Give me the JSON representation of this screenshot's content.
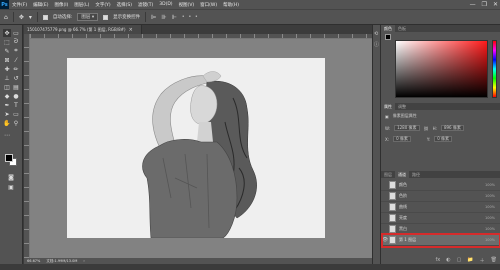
{
  "menubar": {
    "logo": "Ps",
    "items": [
      "文件(F)",
      "编辑(E)",
      "图像(I)",
      "图层(L)",
      "文字(Y)",
      "选择(S)",
      "滤镜(T)",
      "3D(D)",
      "视图(V)",
      "窗口(W)",
      "帮助(H)"
    ],
    "controls": [
      "—",
      "❐",
      "✕"
    ]
  },
  "options": {
    "auto_select_label": "自动选择:",
    "auto_select_value": "图层",
    "transform_label": "显示变换控件",
    "dots": "• • •"
  },
  "document": {
    "tab_title": "150107475779.png @ 66.7% (第 1 图层, RGB/8#)",
    "close": "×",
    "status_zoom": "66.67%",
    "status_size": "文档:1.99M/13.0M"
  },
  "panels": {
    "color_tabs": [
      "颜色",
      "色板"
    ],
    "properties_tabs": [
      "属性",
      "调整"
    ],
    "properties_title": "像素图层属性",
    "w_label": "W:",
    "w_value": "1280 像素",
    "h_label": "H:",
    "h_value": "896 像素",
    "x_label": "X:",
    "x_value": "0 像素",
    "y_label": "Y:",
    "y_value": "0 像素",
    "layer_tabs": [
      "图层",
      "通道",
      "路径"
    ],
    "layers": [
      {
        "name": "颜色",
        "value": "100%"
      },
      {
        "name": "色阶",
        "value": "100%"
      },
      {
        "name": "曲线",
        "value": "100%"
      },
      {
        "name": "亮度",
        "value": "100%"
      },
      {
        "name": "黑白",
        "value": "100%"
      },
      {
        "name": "第 1 图层",
        "value": "100%"
      }
    ],
    "footer_icons": [
      "fx",
      "◐",
      "▢",
      "📁",
      "＋",
      "🗑"
    ]
  },
  "colors": {
    "selection_highlight": "#d62b2b",
    "ps_blue": "#31a8ff"
  }
}
